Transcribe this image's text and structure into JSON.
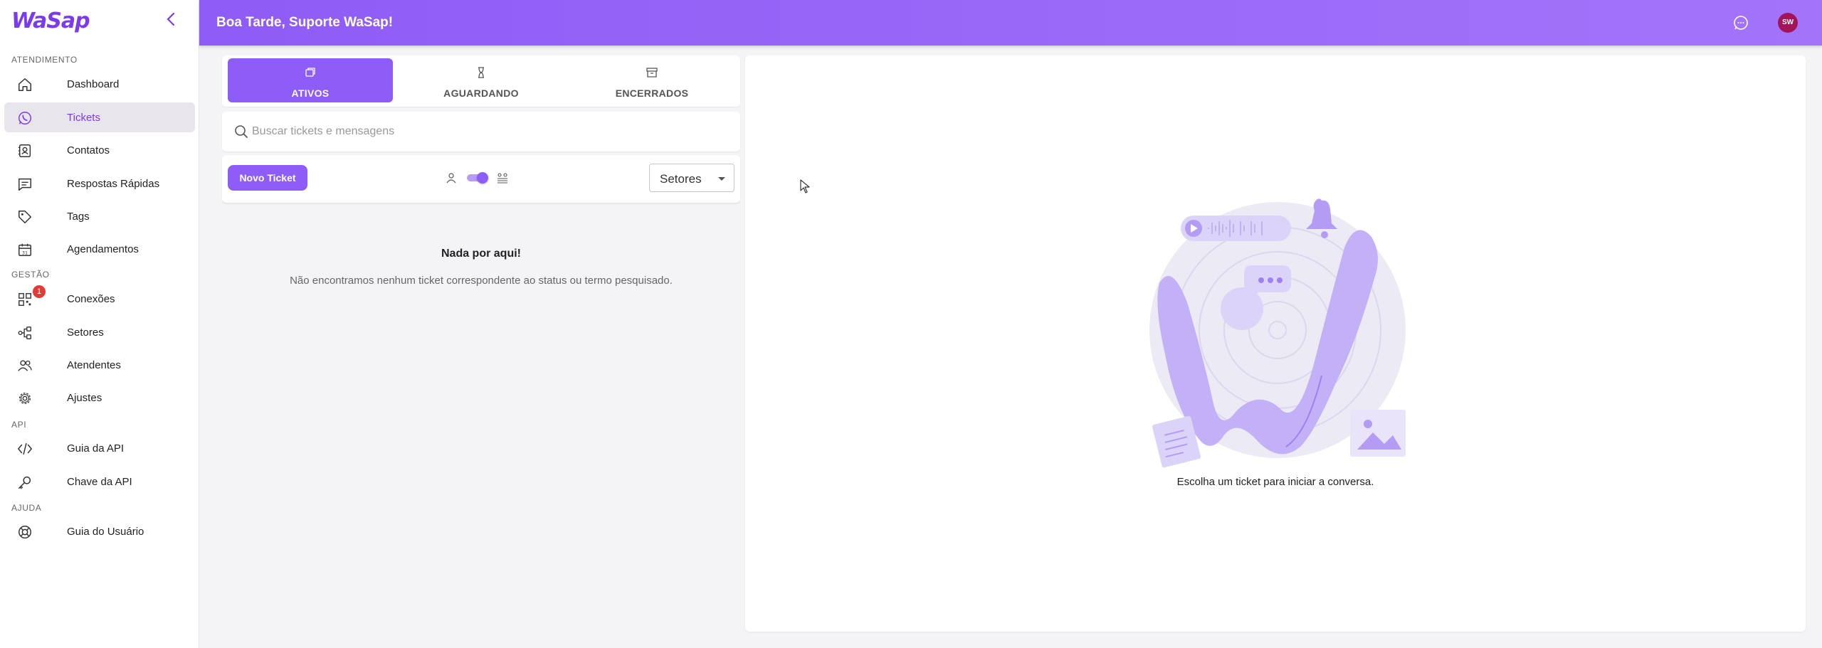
{
  "app": {
    "logo_text": "WaSap"
  },
  "header": {
    "greeting": "Boa Tarde, Suporte WaSap!",
    "avatar_initials": "SW"
  },
  "sidebar": {
    "sections": [
      "ATENDIMENTO",
      "GESTÃO",
      "API",
      "AJUDA"
    ],
    "items": [
      {
        "label": "Dashboard",
        "icon": "home-icon",
        "active": false
      },
      {
        "label": "Tickets",
        "icon": "whatsapp-icon",
        "active": true
      },
      {
        "label": "Contatos",
        "icon": "contact-book-icon",
        "active": false
      },
      {
        "label": "Respostas Rápidas",
        "icon": "message-square-icon",
        "active": false
      },
      {
        "label": "Tags",
        "icon": "tag-icon",
        "active": false
      },
      {
        "label": "Agendamentos",
        "icon": "calendar-icon",
        "active": false
      },
      {
        "label": "Conexões",
        "icon": "qrcode-icon",
        "active": false,
        "badge": "1"
      },
      {
        "label": "Setores",
        "icon": "hierarchy-icon",
        "active": false
      },
      {
        "label": "Atendentes",
        "icon": "users-icon",
        "active": false
      },
      {
        "label": "Ajustes",
        "icon": "gear-icon",
        "active": false
      },
      {
        "label": "Guia da API",
        "icon": "code-icon",
        "active": false
      },
      {
        "label": "Chave da API",
        "icon": "key-icon",
        "active": false
      },
      {
        "label": "Guia do Usuário",
        "icon": "lifebuoy-icon",
        "active": false
      }
    ]
  },
  "tickets": {
    "tabs": [
      {
        "label": "ATIVOS",
        "icon": "copy-icon",
        "active": true
      },
      {
        "label": "AGUARDANDO",
        "icon": "hourglass-icon",
        "active": false
      },
      {
        "label": "ENCERRADOS",
        "icon": "archive-icon",
        "active": false
      }
    ],
    "search": {
      "placeholder": "Buscar tickets e mensagens",
      "value": ""
    },
    "new_ticket_label": "Novo Ticket",
    "show_all_toggle": true,
    "sector_select": {
      "selected": "Setores"
    },
    "empty": {
      "title": "Nada por aqui!",
      "description": "Não encontramos nenhum ticket correspondente ao status ou termo pesquisado."
    }
  },
  "chat": {
    "hint": "Escolha um ticket para iniciar a conversa."
  },
  "colors": {
    "accent": "#8e5cf6",
    "badge": "#e53935",
    "avatar": "#a3155a",
    "illustration": "#c4b0f7"
  }
}
